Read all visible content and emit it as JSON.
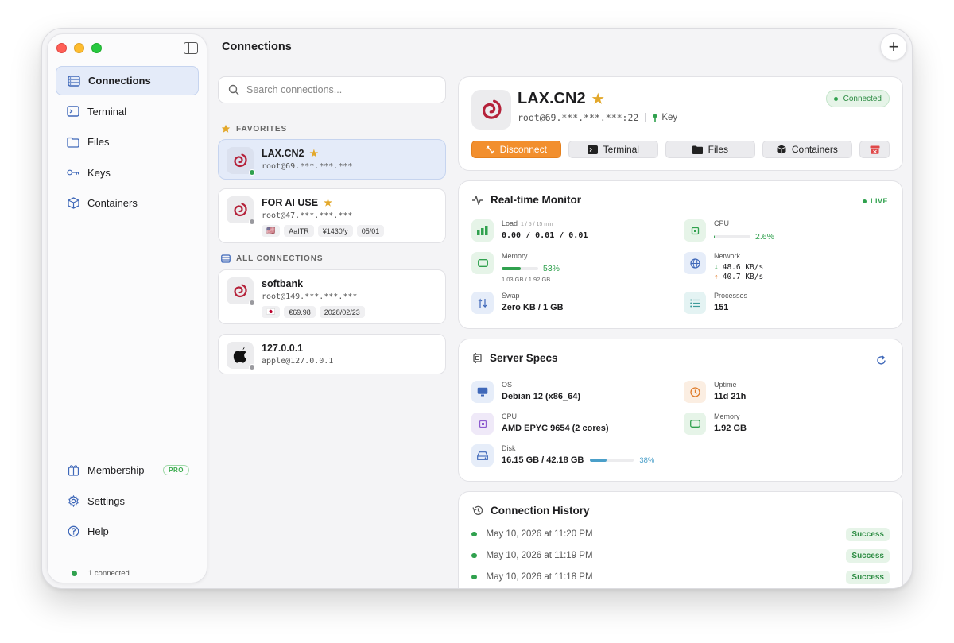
{
  "window": {
    "title": "Connections"
  },
  "sidebar": {
    "items": [
      {
        "label": "Connections",
        "icon": "server-icon",
        "active": true
      },
      {
        "label": "Terminal",
        "icon": "terminal-icon"
      },
      {
        "label": "Files",
        "icon": "folder-icon"
      },
      {
        "label": "Keys",
        "icon": "key-icon"
      },
      {
        "label": "Containers",
        "icon": "box-icon"
      }
    ],
    "bottom": [
      {
        "label": "Membership",
        "icon": "membership-icon",
        "badge": "PRO"
      },
      {
        "label": "Settings",
        "icon": "gear-icon"
      },
      {
        "label": "Help",
        "icon": "help-icon"
      }
    ],
    "status": "1 connected"
  },
  "search": {
    "placeholder": "Search connections..."
  },
  "favorites_label": "FAVORITES",
  "all_label": "ALL CONNECTIONS",
  "connections": [
    {
      "name": "LAX.CN2",
      "addr": "root@69.***.***.***",
      "favorite": true,
      "connected": true,
      "tags": []
    },
    {
      "name": "FOR AI USE",
      "addr": "root@47.***.***.***",
      "favorite": true,
      "connected": false,
      "tags": [
        "🇺🇸",
        "AaITR",
        "¥1430/y",
        "05/01"
      ]
    },
    {
      "name": "softbank",
      "addr": "root@149.***.***.***",
      "favorite": false,
      "connected": false,
      "tags": [
        "🇯🇵",
        "€69.98",
        "2028/02/23"
      ]
    },
    {
      "name": "127.0.0.1",
      "addr": "apple@127.0.0.1",
      "favorite": false,
      "connected": false,
      "tags": []
    }
  ],
  "detail": {
    "name": "LAX.CN2",
    "star": "★",
    "addr": "root@69.***.***.***:22",
    "auth": "Key",
    "status": "Connected",
    "actions": {
      "disconnect": "Disconnect",
      "terminal": "Terminal",
      "files": "Files",
      "containers": "Containers"
    }
  },
  "monitor": {
    "title": "Real-time Monitor",
    "live": "LIVE",
    "load": {
      "label": "Load",
      "sub": "1 / 5 / 15 min",
      "value": "0.00 / 0.01 / 0.01"
    },
    "cpu": {
      "label": "CPU",
      "percent_text": "2.6%",
      "percent": 2.6
    },
    "memory": {
      "label": "Memory",
      "percent_text": "53%",
      "percent": 53,
      "detail": "1.03 GB / 1.92 GB"
    },
    "network": {
      "label": "Network",
      "down": "48.6 KB/s",
      "up": "40.7 KB/s"
    },
    "swap": {
      "label": "Swap",
      "value": "Zero KB / 1 GB"
    },
    "processes": {
      "label": "Processes",
      "value": "151"
    }
  },
  "specs": {
    "title": "Server Specs",
    "os": {
      "label": "OS",
      "value": "Debian 12 (x86_64)"
    },
    "uptime": {
      "label": "Uptime",
      "value": "11d 21h"
    },
    "cpu": {
      "label": "CPU",
      "value": "AMD EPYC 9654 (2 cores)"
    },
    "memory": {
      "label": "Memory",
      "value": "1.92 GB"
    },
    "disk": {
      "label": "Disk",
      "value": "16.15 GB / 42.18 GB",
      "percent_text": "38%",
      "percent": 38
    }
  },
  "history": {
    "title": "Connection History",
    "rows": [
      {
        "time": "May 10, 2026 at 11:20 PM",
        "status": "Success"
      },
      {
        "time": "May 10, 2026 at 11:19 PM",
        "status": "Success"
      },
      {
        "time": "May 10, 2026 at 11:18 PM",
        "status": "Success"
      }
    ]
  },
  "colors": {
    "accent": "#3f68b9",
    "success": "#30a14e",
    "warning": "#f28f2e",
    "star": "#e3a82b"
  }
}
